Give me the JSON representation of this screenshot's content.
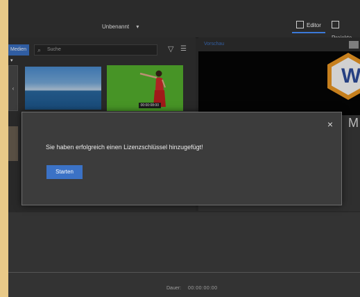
{
  "header": {
    "project_name": "Unbenannt",
    "tabs": [
      {
        "label": "Editor",
        "active": true
      },
      {
        "label": "Projekte",
        "active": false
      }
    ]
  },
  "media_panel": {
    "media_dropdown": "Medien",
    "search_placeholder": "Suche",
    "thumbnails": [
      {
        "kind": "ocean"
      },
      {
        "kind": "green-screen",
        "duration": "00:00:08:00"
      }
    ]
  },
  "preview": {
    "label": "Vorschau",
    "logo_letter": "W",
    "side_letter": "M"
  },
  "dialog": {
    "message": "Sie haben erfolgreich einen Lizenzschlüssel hinzugefügt!",
    "start_button": "Starten",
    "close_symbol": "×"
  },
  "timeline": {
    "duration_label": "Dauer:",
    "duration_value": "00:00:00:00"
  },
  "colors": {
    "accent": "#3b72c6",
    "background": "#2f2f2f",
    "logo_orange": "#f29b24",
    "green_screen": "#57b52f"
  },
  "icons": [
    "dropdown-chevron-icon",
    "editor-icon",
    "projects-icon",
    "search-icon",
    "filter-icon",
    "sort-icon",
    "close-icon"
  ]
}
